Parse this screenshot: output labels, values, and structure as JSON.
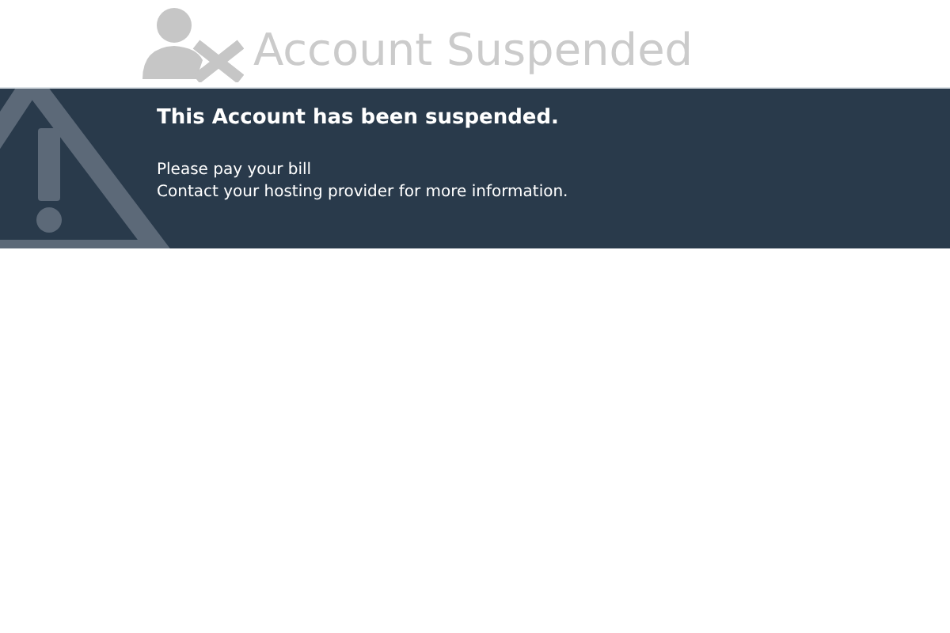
{
  "header": {
    "title": "Account Suspended"
  },
  "banner": {
    "heading": "This Account has been suspended.",
    "lines": [
      "Please pay your bill",
      "Contact your hosting provider for more information."
    ]
  }
}
